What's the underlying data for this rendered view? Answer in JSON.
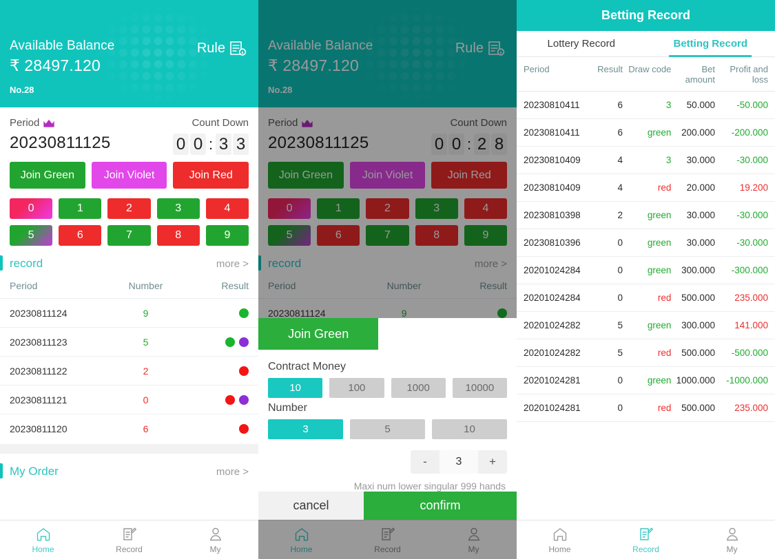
{
  "header": {
    "balance_label": "Available Balance",
    "balance_amount": "₹ 28497.120",
    "no_label": "No.28",
    "rule_label": "Rule",
    "rule_icon": "document-info-icon",
    "accent_color": "#10c4bc"
  },
  "period": {
    "period_label": "Period",
    "crown_icon": "crown-icon",
    "countdown_label": "Count Down",
    "period_number": "20230811125",
    "countdown_p1": {
      "d1": "0",
      "d2": "0",
      "sep": ":",
      "d3": "3",
      "d4": "3"
    },
    "countdown_p2": {
      "d1": "0",
      "d2": "0",
      "sep": ":",
      "d3": "2",
      "d4": "8"
    }
  },
  "joins": [
    {
      "label": "Join Green",
      "color": "#22a530",
      "key": "green"
    },
    {
      "label": "Join Violet",
      "color": "#e247ea",
      "key": "violet"
    },
    {
      "label": "Join Red",
      "color": "#ee2c2c",
      "key": "red"
    }
  ],
  "numbers": [
    {
      "n": "0",
      "style": "redviolet"
    },
    {
      "n": "1",
      "style": "green"
    },
    {
      "n": "2",
      "style": "red"
    },
    {
      "n": "3",
      "style": "green"
    },
    {
      "n": "4",
      "style": "red"
    },
    {
      "n": "5",
      "style": "greenviolet"
    },
    {
      "n": "6",
      "style": "red"
    },
    {
      "n": "7",
      "style": "green"
    },
    {
      "n": "8",
      "style": "red"
    },
    {
      "n": "9",
      "style": "green"
    }
  ],
  "record": {
    "title": "record",
    "more": "more >",
    "columns": [
      "Period",
      "Number",
      "Result"
    ],
    "rows": [
      {
        "period": "20230811124",
        "number": "9",
        "number_color": "green",
        "dots": [
          "green"
        ]
      },
      {
        "period": "20230811123",
        "number": "5",
        "number_color": "green",
        "dots": [
          "green",
          "violet"
        ]
      },
      {
        "period": "20230811122",
        "number": "2",
        "number_color": "red",
        "dots": [
          "red"
        ]
      },
      {
        "period": "20230811121",
        "number": "0",
        "number_color": "red",
        "dots": [
          "red",
          "violet"
        ]
      },
      {
        "period": "20230811120",
        "number": "6",
        "number_color": "red",
        "dots": [
          "red"
        ]
      }
    ]
  },
  "my_order": {
    "title": "My Order",
    "more": "more >"
  },
  "tabbar": {
    "home": "Home",
    "record": "Record",
    "my": "My",
    "home_icon": "home-icon",
    "record_icon": "note-edit-icon",
    "my_icon": "person-icon",
    "active_panel1": "home",
    "active_panel3": "record"
  },
  "modal": {
    "tab_label": "Join Green",
    "contract_money_label": "Contract Money",
    "money_options": [
      "10",
      "100",
      "1000",
      "10000"
    ],
    "money_selected": "10",
    "number_label": "Number",
    "number_options": [
      "3",
      "5",
      "10"
    ],
    "number_selected": "3",
    "stepper": {
      "minus": "-",
      "value": "3",
      "plus": "+"
    },
    "hint": "Maxi num lower singular 999 hands",
    "cancel_label": "cancel",
    "confirm_label": "confirm"
  },
  "betting": {
    "title": "Betting Record",
    "tabs": [
      {
        "label": "Lottery Record",
        "active": false
      },
      {
        "label": "Betting Record",
        "active": true
      }
    ],
    "columns": [
      "Period",
      "Result",
      "Draw code",
      "Bet amount",
      "Profit and loss"
    ],
    "rows": [
      {
        "period": "20230810411",
        "result": "6",
        "draw": "3",
        "draw_color": "green",
        "bet": "50.000",
        "pl": "-50.000",
        "pl_color": "green"
      },
      {
        "period": "20230810411",
        "result": "6",
        "draw": "green",
        "draw_color": "green",
        "bet": "200.000",
        "pl": "-200.000",
        "pl_color": "green"
      },
      {
        "period": "20230810409",
        "result": "4",
        "draw": "3",
        "draw_color": "green",
        "bet": "30.000",
        "pl": "-30.000",
        "pl_color": "green"
      },
      {
        "period": "20230810409",
        "result": "4",
        "draw": "red",
        "draw_color": "red",
        "bet": "20.000",
        "pl": "19.200",
        "pl_color": "red"
      },
      {
        "period": "20230810398",
        "result": "2",
        "draw": "green",
        "draw_color": "green",
        "bet": "30.000",
        "pl": "-30.000",
        "pl_color": "green"
      },
      {
        "period": "20230810396",
        "result": "0",
        "draw": "green",
        "draw_color": "green",
        "bet": "30.000",
        "pl": "-30.000",
        "pl_color": "green"
      },
      {
        "period": "20201024284",
        "result": "0",
        "draw": "green",
        "draw_color": "green",
        "bet": "300.000",
        "pl": "-300.000",
        "pl_color": "green"
      },
      {
        "period": "20201024284",
        "result": "0",
        "draw": "red",
        "draw_color": "red",
        "bet": "500.000",
        "pl": "235.000",
        "pl_color": "red"
      },
      {
        "period": "20201024282",
        "result": "5",
        "draw": "green",
        "draw_color": "green",
        "bet": "300.000",
        "pl": "141.000",
        "pl_color": "red"
      },
      {
        "period": "20201024282",
        "result": "5",
        "draw": "red",
        "draw_color": "red",
        "bet": "500.000",
        "pl": "-500.000",
        "pl_color": "green"
      },
      {
        "period": "20201024281",
        "result": "0",
        "draw": "green",
        "draw_color": "green",
        "bet": "1000.000",
        "pl": "-1000.000",
        "pl_color": "green"
      },
      {
        "period": "20201024281",
        "result": "0",
        "draw": "red",
        "draw_color": "red",
        "bet": "500.000",
        "pl": "235.000",
        "pl_color": "red"
      }
    ]
  }
}
